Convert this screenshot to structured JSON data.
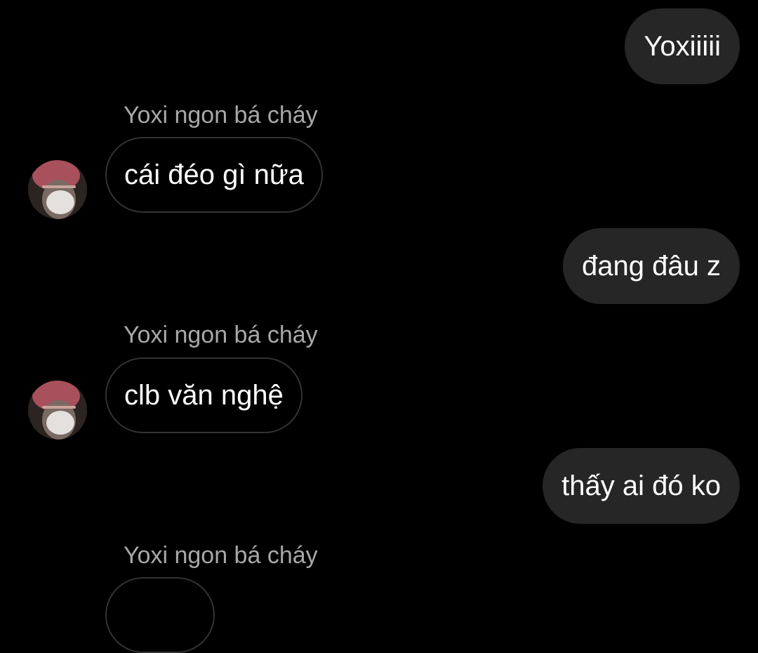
{
  "contact": {
    "name": "Yoxi ngon bá cháy"
  },
  "messages": [
    {
      "direction": "outgoing",
      "text": "Yoxiiiii"
    },
    {
      "direction": "incoming",
      "sender": "Yoxi ngon bá cháy",
      "text": "cái đéo gì nữa",
      "avatar_icon": "user-avatar"
    },
    {
      "direction": "outgoing",
      "text": "đang đâu z"
    },
    {
      "direction": "incoming",
      "sender": "Yoxi ngon bá cháy",
      "text": "clb văn nghệ",
      "avatar_icon": "user-avatar"
    },
    {
      "direction": "outgoing",
      "text": "thấy ai đó ko"
    },
    {
      "direction": "incoming",
      "sender": "Yoxi ngon bá cháy",
      "text": ""
    }
  ],
  "colors": {
    "background": "#000000",
    "outgoing_bubble": "#262626",
    "incoming_border": "#333333",
    "sender_text": "#a8a8a8",
    "message_text": "#ffffff"
  }
}
